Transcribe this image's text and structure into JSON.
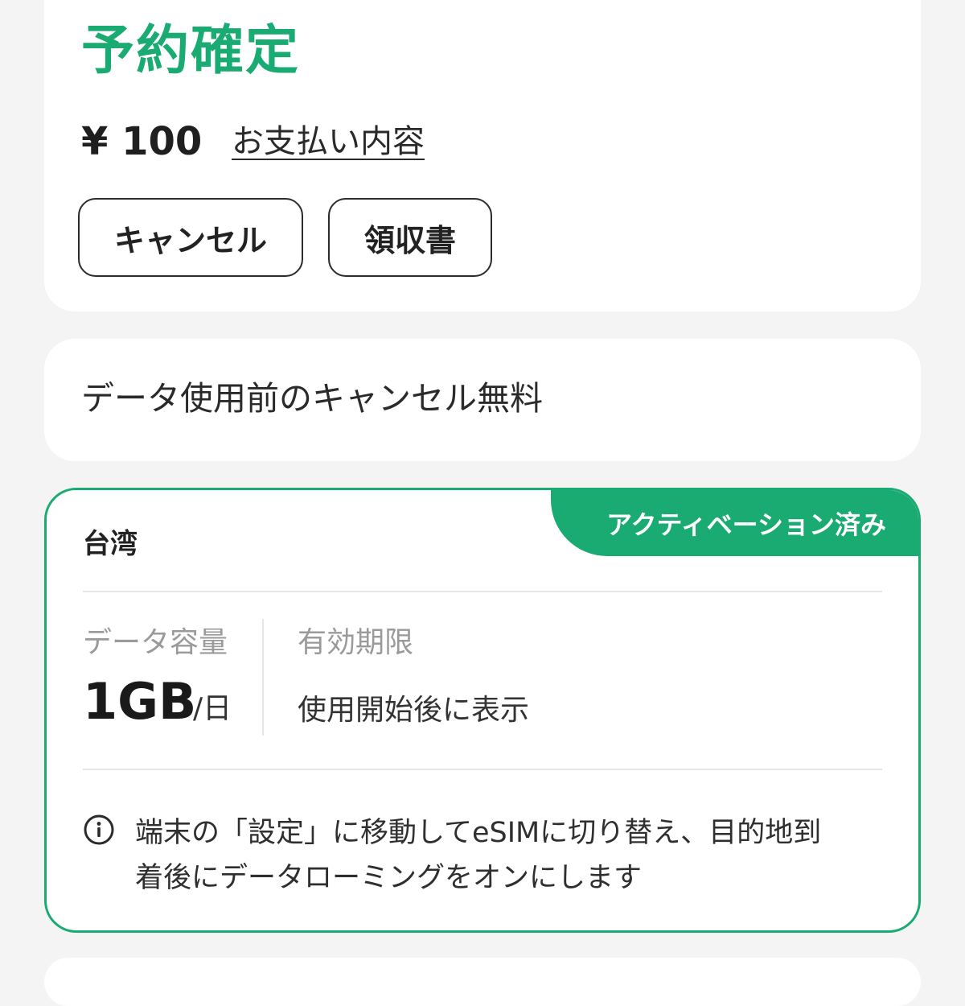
{
  "booking": {
    "status": "予約確定",
    "price": "¥ 100",
    "payment_link": "お支払い内容",
    "cancel_button": "キャンセル",
    "receipt_button": "領収書"
  },
  "note": {
    "text": "データ使用前のキャンセル無料"
  },
  "esim": {
    "badge": "アクティベーション済み",
    "country": "台湾",
    "data_label": "データ容量",
    "data_value": "1GB",
    "data_unit": "/日",
    "expiry_label": "有効期限",
    "expiry_value": "使用開始後に表示",
    "info_line1": "端末の「設定」に移動してeSIMに切り替え、目的地到",
    "info_line2": "着後にデータローミングをオンにします",
    "info_icon": "info-icon"
  },
  "colors": {
    "accent": "#1aab72",
    "background": "#f4f4f4",
    "card": "#ffffff",
    "muted_text": "#9a9a9a"
  }
}
